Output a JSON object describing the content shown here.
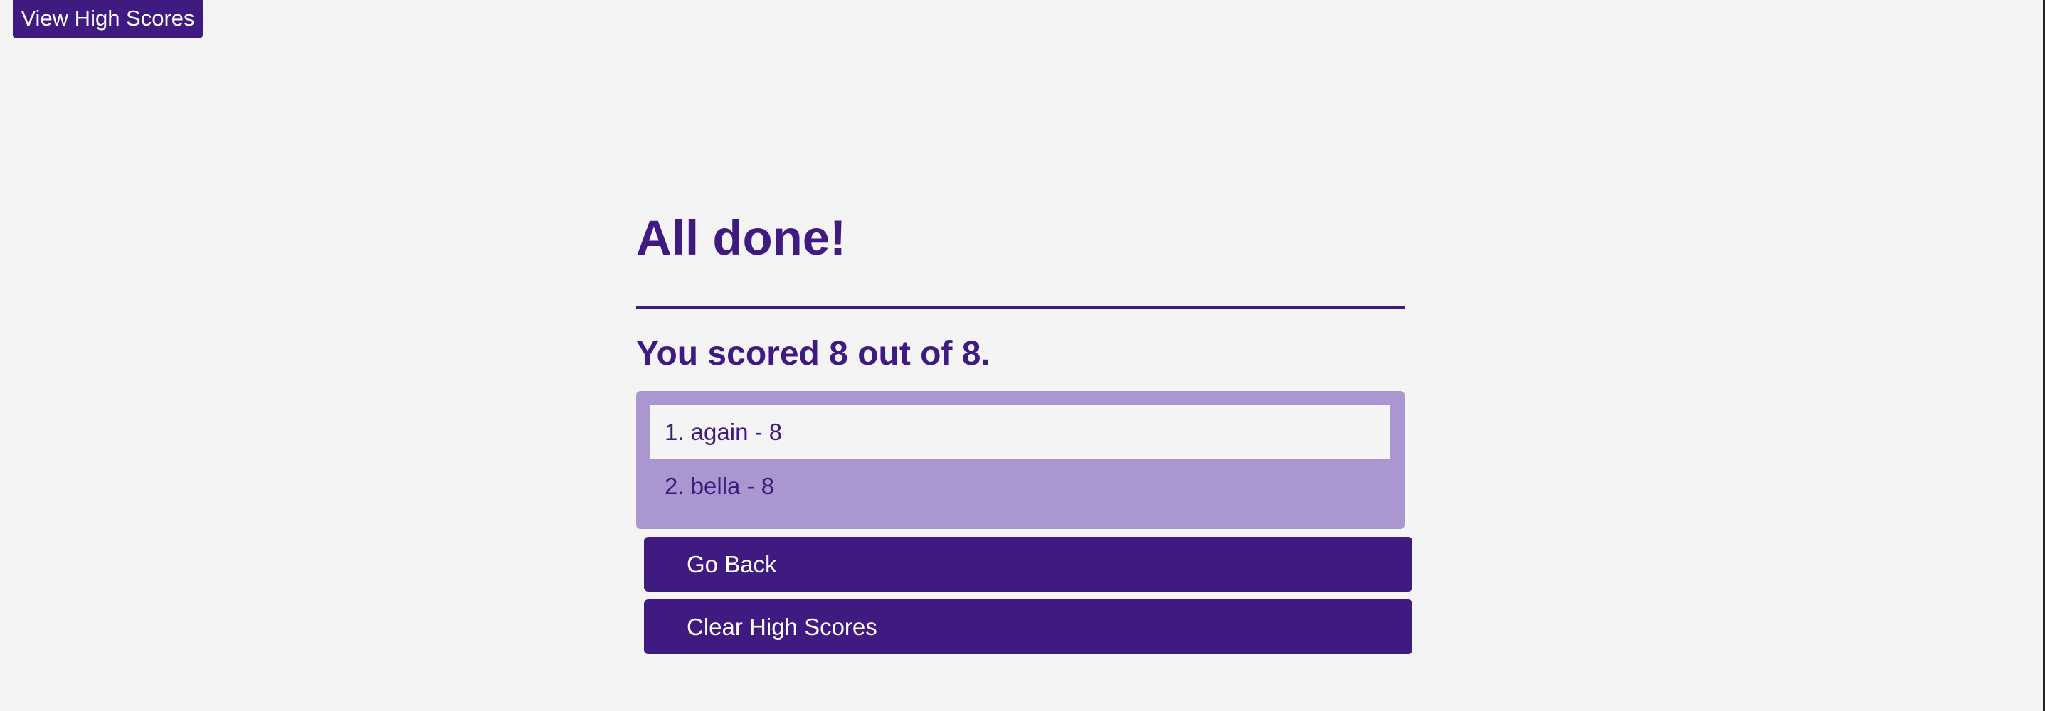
{
  "header": {
    "view_high_scores_label": "View High Scores"
  },
  "main": {
    "title": "All done!",
    "score_text": "You scored 8 out of 8.",
    "high_scores": [
      {
        "label": "1. again - 8"
      },
      {
        "label": "2. bella - 8"
      }
    ],
    "go_back_label": "Go Back",
    "clear_label": "Clear High Scores"
  },
  "colors": {
    "primary": "#3f1a80",
    "list_background": "#ab97cf",
    "page_background": "#f4f4f4",
    "button_text": "#ffffff"
  }
}
